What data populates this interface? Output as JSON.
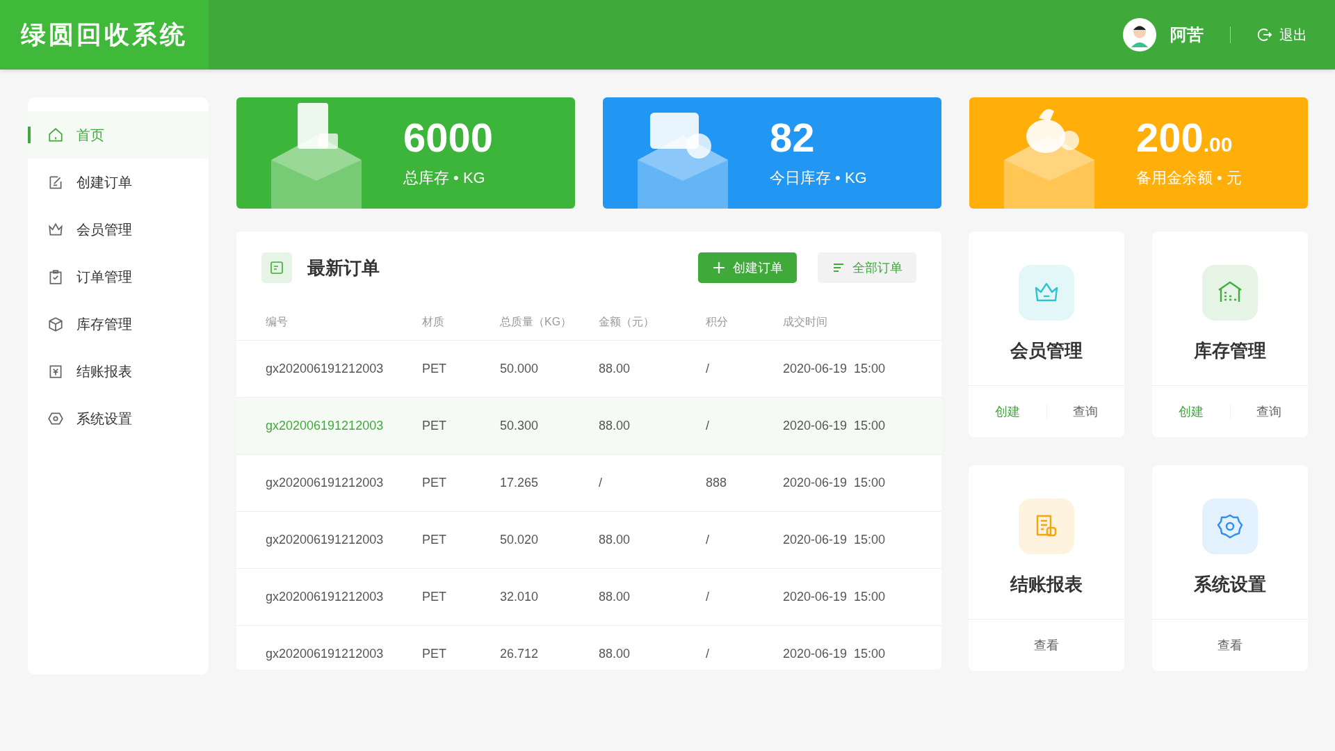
{
  "header": {
    "title": "绿圆回收系统",
    "user": "阿苦",
    "logout": "退出"
  },
  "sidebar": {
    "items": [
      {
        "label": "首页",
        "kind": "home",
        "selected": true
      },
      {
        "label": "创建订单",
        "kind": "edit",
        "selected": false
      },
      {
        "label": "会员管理",
        "kind": "crown",
        "selected": false
      },
      {
        "label": "订单管理",
        "kind": "clipboard",
        "selected": false
      },
      {
        "label": "库存管理",
        "kind": "box",
        "selected": false
      },
      {
        "label": "结账报表",
        "kind": "yen",
        "selected": false
      },
      {
        "label": "系统设置",
        "kind": "hexagon",
        "selected": false
      }
    ]
  },
  "stats": [
    {
      "kind": "document",
      "color": "#3db53a",
      "value": "6000",
      "label": "总库存 • KG"
    },
    {
      "kind": "calendar",
      "color": "#2196f3",
      "value": "82",
      "label": "今日库存 • KG"
    },
    {
      "kind": "moneybag",
      "color": "#ffae0a",
      "value": "200",
      "value_small": ".00",
      "label": "备用金余额 • 元"
    }
  ],
  "orders": {
    "title": "最新订单",
    "buttons": [
      {
        "label": "创建订单",
        "kind": "plus"
      },
      {
        "label": "全部订单",
        "kind": "list"
      }
    ],
    "columns": [
      "编号",
      "材质",
      "总质量（KG）",
      "金额（元）",
      "积分",
      "成交时间"
    ],
    "rows": [
      {
        "selected": false,
        "cells": [
          "gx202006191212003",
          "PET",
          "50.000",
          "88.00",
          "/",
          "2020-06-19  15:00"
        ]
      },
      {
        "selected": true,
        "cells": [
          "gx202006191212003",
          "PET",
          "50.300",
          "88.00",
          "/",
          "2020-06-19  15:00"
        ]
      },
      {
        "selected": false,
        "cells": [
          "gx202006191212003",
          "PET",
          "17.265",
          "/",
          "888",
          "2020-06-19  15:00"
        ]
      },
      {
        "selected": false,
        "cells": [
          "gx202006191212003",
          "PET",
          "50.020",
          "88.00",
          "/",
          "2020-06-19  15:00"
        ]
      },
      {
        "selected": false,
        "cells": [
          "gx202006191212003",
          "PET",
          "32.010",
          "88.00",
          "/",
          "2020-06-19  15:00"
        ]
      },
      {
        "selected": false,
        "cells": [
          "gx202006191212003",
          "PET",
          "26.712",
          "88.00",
          "/",
          "2020-06-19  15:00"
        ]
      }
    ]
  },
  "shortcuts": [
    {
      "title": "会员管理",
      "kind": "crown",
      "color": "#2ec4cf",
      "actions": [
        {
          "label": "创建",
          "primary": true
        },
        {
          "label": "查询",
          "primary": false
        }
      ]
    },
    {
      "title": "库存管理",
      "kind": "warehouse",
      "color": "#3daf3a",
      "actions": [
        {
          "label": "创建",
          "primary": true
        },
        {
          "label": "查询",
          "primary": false
        }
      ]
    },
    {
      "title": "结账报表",
      "kind": "report",
      "color": "#f5a60a",
      "actions": [
        {
          "label": "查看",
          "primary": false
        }
      ]
    },
    {
      "title": "系统设置",
      "kind": "gear",
      "color": "#2f8ff0",
      "actions": [
        {
          "label": "查看",
          "primary": false
        }
      ]
    }
  ]
}
